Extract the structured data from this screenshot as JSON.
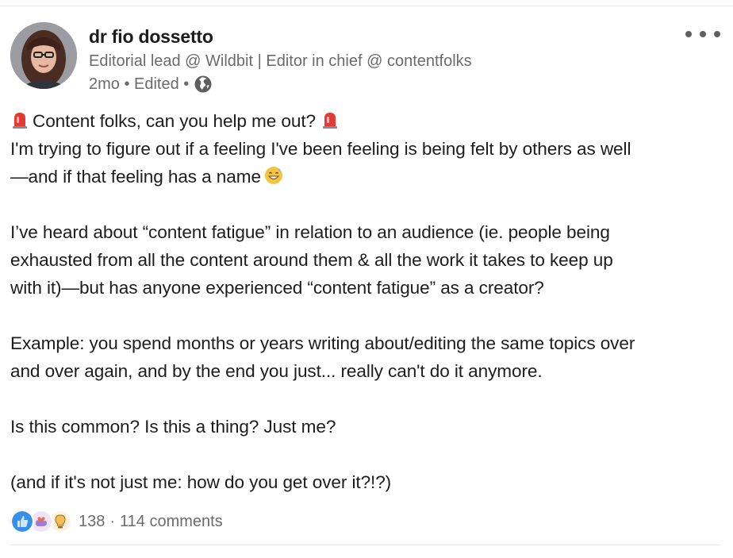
{
  "author": {
    "name": "dr fio dossetto",
    "headline": "Editorial lead @ Wildbit | Editor in chief @ contentfolks",
    "meta": "2mo • Edited •"
  },
  "post": {
    "line1": "Content folks, can you help me out?",
    "line2": "I'm trying to figure out if a feeling I've been feeling is being felt by others as well",
    "line3": "—and if that feeling has a name",
    "line4": "I’ve heard about “content fatigue” in relation to an audience (ie. people being",
    "line5": "exhausted from all the content around them & all the work it takes to keep up",
    "line6": "with it)—but has anyone experienced “content fatigue” as a creator?",
    "line7": "Example: you spend months or years writing about/editing the same topics over",
    "line8": "and over again, and by the end you just... really can't do it anymore.",
    "line9": "Is this common? Is this a thing? Just me?",
    "line10": "(and if it's not just me: how do you get over it?!?)"
  },
  "social": {
    "reaction_count": "138",
    "separator": "·",
    "comments": "114 comments",
    "reactions": [
      "like-icon",
      "love-icon",
      "insightful-icon"
    ]
  },
  "colors": {
    "like": "#378fe9",
    "love": "#df704d",
    "insightful": "#f5bb5c",
    "muted_text": "#6b6b6b"
  }
}
